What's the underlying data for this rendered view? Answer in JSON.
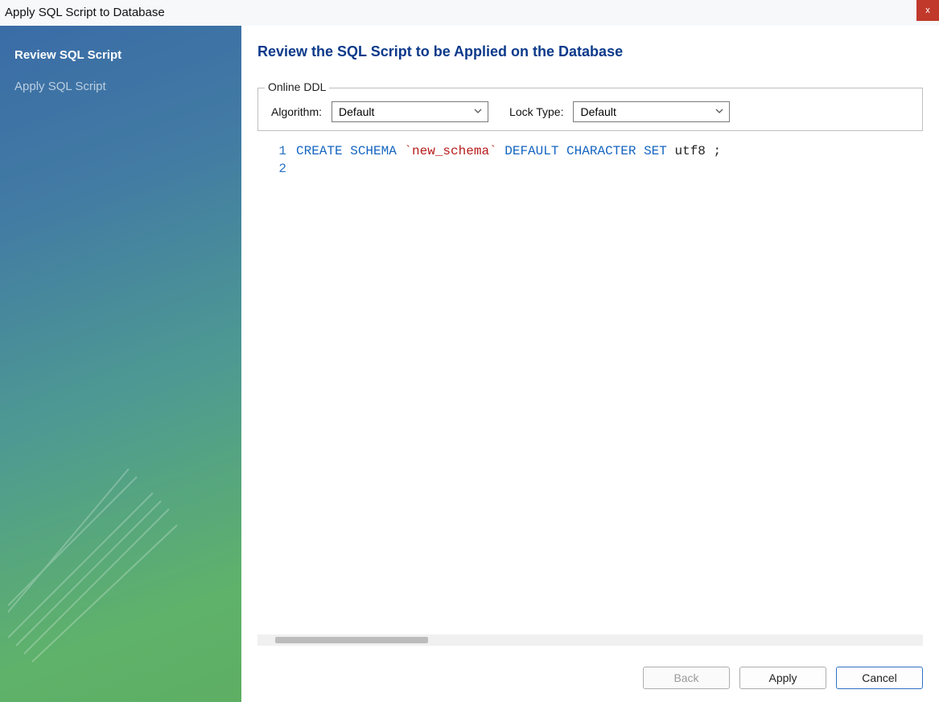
{
  "window": {
    "title": "Apply SQL Script to Database",
    "close_glyph": "x"
  },
  "sidebar": {
    "step_active": "Review SQL Script",
    "step_next": "Apply SQL Script"
  },
  "main": {
    "heading": "Review the SQL Script to be Applied on the Database",
    "ddl": {
      "legend": "Online DDL",
      "algorithm_label": "Algorithm:",
      "algorithm_value": "Default",
      "lock_label": "Lock Type:",
      "lock_value": "Default"
    },
    "editor": {
      "line_numbers": [
        "1",
        "2"
      ],
      "line1_kw1": "CREATE SCHEMA ",
      "line1_str": "`new_schema`",
      "line1_kw2": " DEFAULT CHARACTER SET ",
      "line1_plain": "utf8 ;"
    },
    "buttons": {
      "back": "Back",
      "apply": "Apply",
      "cancel": "Cancel"
    }
  }
}
